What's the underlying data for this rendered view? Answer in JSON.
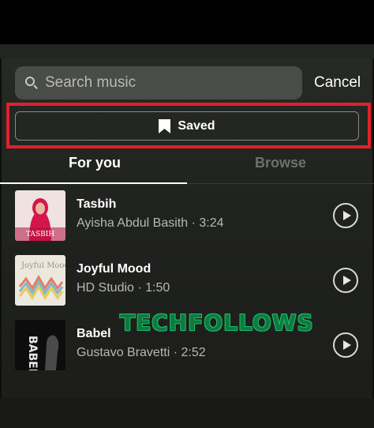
{
  "search": {
    "placeholder": "Search music",
    "cancel_label": "Cancel"
  },
  "saved_button": {
    "label": "Saved",
    "icon": "bookmark-icon"
  },
  "tabs": [
    {
      "label": "For you",
      "active": true
    },
    {
      "label": "Browse",
      "active": false
    }
  ],
  "tracks": [
    {
      "title": "Tasbih",
      "subtitle": "Ayisha Abdul Basith · 3:24",
      "art_text": "TASBIH",
      "art_colors": [
        "#f3e8e6",
        "#d4164c"
      ]
    },
    {
      "title": "Joyful Mood",
      "subtitle": "HD Studio · 1:50",
      "art_text": "Joyful Mood",
      "art_colors": [
        "#ece8dd",
        "#c9c2a8"
      ]
    },
    {
      "title": "Babel",
      "subtitle": "Gustavo Bravetti · 2:52",
      "art_text": "BABEL",
      "art_colors": [
        "#0d0d0d",
        "#3c3c3c"
      ]
    }
  ],
  "watermark": "TECHFOLLOWS",
  "colors": {
    "highlight": "#e3202d",
    "watermark": "#1db86a"
  }
}
